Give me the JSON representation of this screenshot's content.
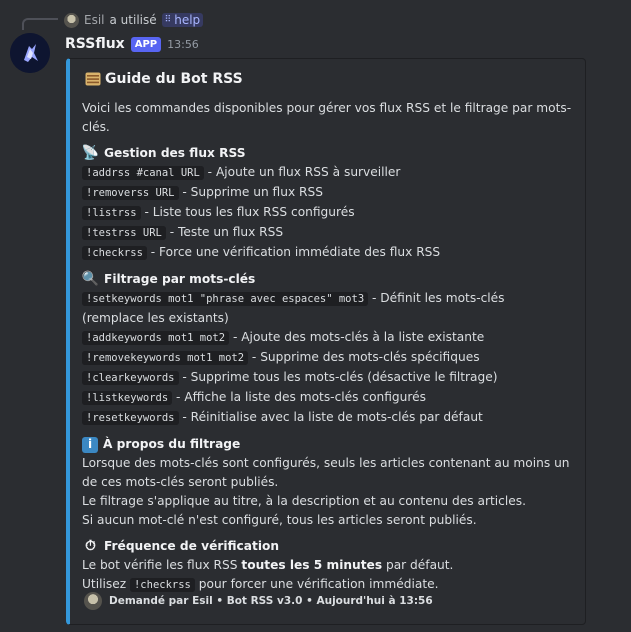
{
  "reply": {
    "user": "Esil",
    "action": "a utilisé",
    "command": "help"
  },
  "message": {
    "bot_name": "RSSflux",
    "badge": "APP",
    "time": "13:56"
  },
  "embed": {
    "accent_color": "#3498db",
    "title": "Guide du Bot RSS",
    "intro_line1": "Voici les commandes disponibles pour gérer vos flux RSS et le filtrage par mots-",
    "intro_line2": "clés.",
    "sections": {
      "rss": {
        "title": "Gestion des flux RSS",
        "icon": "satellite-icon",
        "items": [
          {
            "code": "!addrss #canal URL",
            "desc": " - Ajoute un flux RSS à surveiller"
          },
          {
            "code": "!removerss URL",
            "desc": " - Supprime un flux RSS"
          },
          {
            "code": "!listrss",
            "desc": " - Liste tous les flux RSS configurés"
          },
          {
            "code": "!testrss URL",
            "desc": " - Teste un flux RSS"
          },
          {
            "code": "!checkrss",
            "desc": " - Force une vérification immédiate des flux RSS"
          }
        ]
      },
      "keywords": {
        "title": "Filtrage par mots-clés",
        "icon": "magnifier-icon",
        "first_code": "!setkeywords mot1 \"phrase avec espaces\" mot3",
        "first_desc": " - Définit les mots-clés",
        "first_desc_cont": "(remplace les existants)",
        "items": [
          {
            "code": "!addkeywords mot1 mot2",
            "desc": " - Ajoute des mots-clés à la liste existante"
          },
          {
            "code": "!removekeywords mot1 mot2",
            "desc": " - Supprime des mots-clés spécifiques"
          },
          {
            "code": "!clearkeywords",
            "desc": " - Supprime tous les mots-clés (désactive le filtrage)"
          },
          {
            "code": "!listkeywords",
            "desc": " - Affiche la liste des mots-clés configurés"
          },
          {
            "code": "!resetkeywords",
            "desc": " - Réinitialise avec la liste de mots-clés par défaut"
          }
        ]
      },
      "about": {
        "title": "À propos du filtrage",
        "icon": "info-icon",
        "lines": [
          "Lorsque des mots-clés sont configurés, seuls les articles contenant au moins un",
          "de ces mots-clés seront publiés.",
          "Le filtrage s'applique au titre, à la description et au contenu des articles.",
          "Si aucun mot-clé n'est configuré, tous les articles seront publiés."
        ]
      },
      "frequency": {
        "title": "Fréquence de vérification",
        "icon": "stopwatch-icon",
        "line1_pre": "Le bot vérifie les flux RSS ",
        "line1_bold": "toutes les 5 minutes",
        "line1_post": " par défaut.",
        "line2_pre": "Utilisez ",
        "line2_code": "!checkrss",
        "line2_post": " pour forcer une vérification immédiate."
      }
    },
    "footer": "Demandé par Esil • Bot RSS v3.0 • Aujourd'hui à 13:56"
  }
}
